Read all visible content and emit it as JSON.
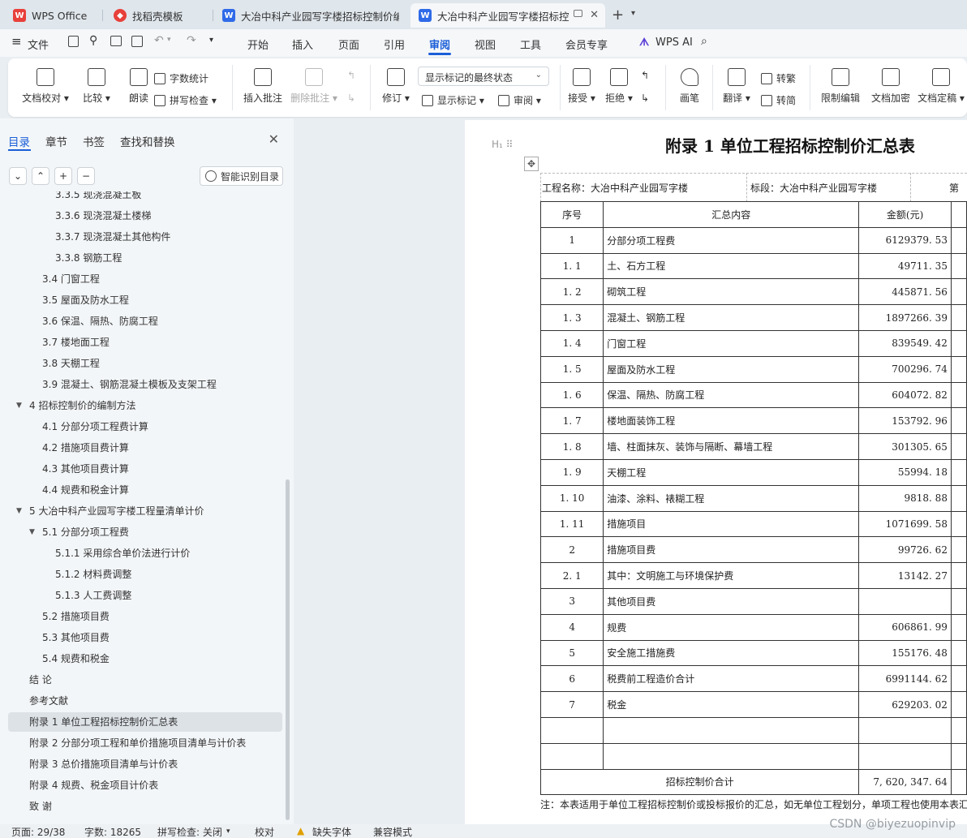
{
  "tabs": [
    {
      "label": "WPS Office",
      "icon": "wps-logo-icon"
    },
    {
      "label": "找稻壳模板",
      "icon": "docer-icon"
    },
    {
      "label": "大冶中科产业园写字楼招标控制价编制",
      "icon": "writer-doc-icon"
    },
    {
      "label": "大冶中科产业园写字楼招标控",
      "icon": "writer-doc-icon",
      "active": true
    }
  ],
  "menu": {
    "file": "文件",
    "items": [
      "开始",
      "插入",
      "页面",
      "引用",
      "审阅",
      "视图",
      "工具",
      "会员专享"
    ],
    "active": "审阅",
    "ai": "WPS AI"
  },
  "ribbon": {
    "doc_check": "文档校对",
    "compare": "比较",
    "read_aloud": "朗读",
    "word_count": "字数统计",
    "spell_check": "拼写检查",
    "insert_comment": "插入批注",
    "delete_comment": "删除批注",
    "track": "修订",
    "markup_select": "显示标记的最终状态",
    "show_markup": "显示标记",
    "review": "审阅",
    "accept": "接受",
    "reject": "拒绝",
    "pen": "画笔",
    "translate": "翻译",
    "to_traditional": "转繁",
    "to_simplified": "转简",
    "restrict_edit": "限制编辑",
    "encrypt": "文档加密",
    "finalize": "文档定稿"
  },
  "panel": {
    "tabs": [
      "目录",
      "章节",
      "书签",
      "查找和替换"
    ],
    "smart_toc": "智能识别目录",
    "toc": [
      {
        "label": "3.3.5  现浇混凝土板",
        "level": 3
      },
      {
        "label": "3.3.6  现浇混凝土楼梯",
        "level": 3
      },
      {
        "label": "3.3.7  现浇混凝土其他构件",
        "level": 3
      },
      {
        "label": "3.3.8  钢筋工程",
        "level": 3
      },
      {
        "label": "3.4  门窗工程",
        "level": 2
      },
      {
        "label": "3.5  屋面及防水工程",
        "level": 2
      },
      {
        "label": "3.6  保温、隔热、防腐工程",
        "level": 2
      },
      {
        "label": "3.7  楼地面工程",
        "level": 2
      },
      {
        "label": "3.8  天棚工程",
        "level": 2
      },
      {
        "label": "3.9  混凝土、钢筋混凝土模板及支架工程",
        "level": 2
      },
      {
        "label": "4  招标控制价的编制方法",
        "level": 1,
        "expanded": true
      },
      {
        "label": "4.1  分部分项工程费计算",
        "level": 2
      },
      {
        "label": "4.2  措施项目费计算",
        "level": 2
      },
      {
        "label": "4.3  其他项目费计算",
        "level": 2
      },
      {
        "label": "4.4  规费和税金计算",
        "level": 2
      },
      {
        "label": "5 大冶中科产业园写字楼工程量清单计价",
        "level": 1,
        "expanded": true
      },
      {
        "label": "5.1  分部分项工程费",
        "level": 2,
        "expanded": true
      },
      {
        "label": "5.1.1 采用综合单价法进行计价",
        "level": 3
      },
      {
        "label": "5.1.2 材料费调整",
        "level": 3
      },
      {
        "label": "5.1.3 人工费调整",
        "level": 3
      },
      {
        "label": "5.2  措施项目费",
        "level": 2
      },
      {
        "label": "5.3  其他项目费",
        "level": 2
      },
      {
        "label": "5.4  规费和税金",
        "level": 2
      },
      {
        "label": "结    论",
        "level": 1
      },
      {
        "label": "参考文献",
        "level": 1
      },
      {
        "label": "附录 1 单位工程招标控制价汇总表",
        "level": 1,
        "selected": true
      },
      {
        "label": "附录 2 分部分项工程和单价措施项目清单与计价表",
        "level": 1
      },
      {
        "label": "附录 3 总价措施项目清单与计价表",
        "level": 1
      },
      {
        "label": "附录 4 规费、税金项目计价表",
        "level": 1
      },
      {
        "label": "致    谢",
        "level": 1
      }
    ]
  },
  "document": {
    "title": "附录 1 单位工程招标控制价汇总表",
    "project": "工程名称：大冶中科产业园写字楼",
    "section": "标段：大冶中科产业园写字楼",
    "page_label": "第",
    "headers": [
      "序号",
      "汇总内容",
      "金额(元)"
    ],
    "rows": [
      [
        "1",
        "分部分项工程费",
        "6129379. 53"
      ],
      [
        "1. 1",
        "土、石方工程",
        "49711. 35"
      ],
      [
        "1. 2",
        "砌筑工程",
        "445871. 56"
      ],
      [
        "1. 3",
        "混凝土、钢筋工程",
        "1897266. 39"
      ],
      [
        "1. 4",
        "门窗工程",
        "839549. 42"
      ],
      [
        "1. 5",
        "屋面及防水工程",
        "700296. 74"
      ],
      [
        "1. 6",
        "保温、隔热、防腐工程",
        "604072. 82"
      ],
      [
        "1. 7",
        "楼地面装饰工程",
        "153792. 96"
      ],
      [
        "1. 8",
        "墙、柱面抹灰、装饰与隔断、幕墙工程",
        "301305. 65"
      ],
      [
        "1. 9",
        "天棚工程",
        "55994. 18"
      ],
      [
        "1. 10",
        "油漆、涂料、裱糊工程",
        "9818. 88"
      ],
      [
        "1. 11",
        "措施项目",
        "1071699. 58"
      ],
      [
        "2",
        "措施项目费",
        "99726. 62"
      ],
      [
        "2. 1",
        "其中：文明施工与环境保护费",
        "13142. 27"
      ],
      [
        "3",
        "其他项目费",
        ""
      ],
      [
        "4",
        "规费",
        "606861. 99"
      ],
      [
        "5",
        "安全施工措施费",
        "155176. 48"
      ],
      [
        "6",
        "税费前工程造价合计",
        "6991144. 62"
      ],
      [
        "7",
        "税金",
        "629203. 02"
      ],
      [
        "",
        "",
        ""
      ],
      [
        "",
        "",
        ""
      ]
    ],
    "total_label": "招标控制价合计",
    "total_value": "7, 620, 347. 64",
    "footnote": "注：本表适用于单位工程招标控制价或投标报价的汇总，如无单位工程划分，单项工程也使用本表汇"
  },
  "status": {
    "page": "页面: 29/38",
    "words": "字数: 18265",
    "spell": "拼写检查: 关闭",
    "proof": "校对",
    "missing_font": "缺失字体",
    "compat": "兼容模式"
  },
  "watermark": "CSDN @biyezuopinvip",
  "colors": {
    "accent": "#1a5ed8",
    "wps_red": "#e8403a",
    "writer_blue": "#2f6ae8"
  }
}
